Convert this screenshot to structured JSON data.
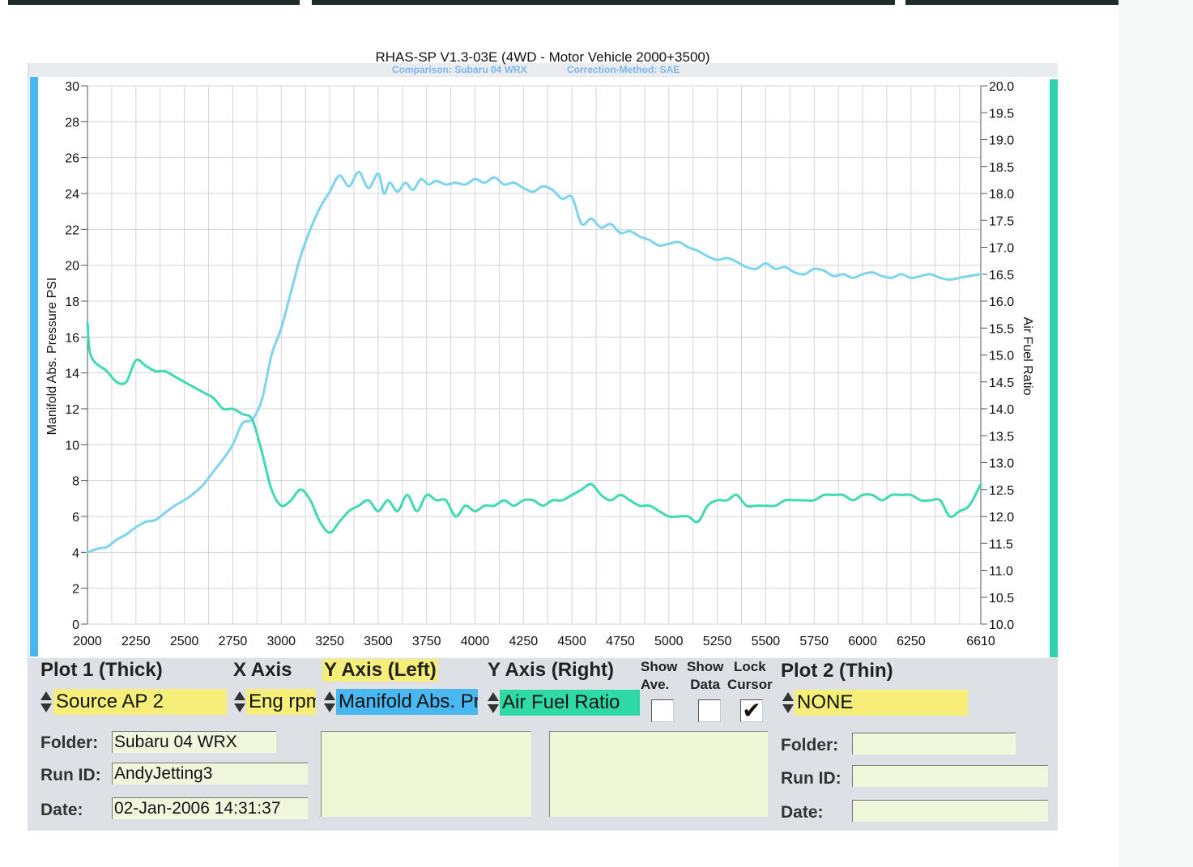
{
  "header": {
    "title": "RHAS-SP V1.3-03E  (4WD - Motor Vehicle 2000+3500)",
    "comparison": "Comparison: Subaru 04 WRX",
    "correction": "Correction-Method: SAE"
  },
  "colors": {
    "left_series": "#7cd4ee",
    "right_series": "#3fd9b3",
    "left_accent": "#45b7ee",
    "right_accent": "#2fd3a9",
    "plot1_highlight": "#f5ef7a",
    "y_left_highlight": "#49b8f0",
    "y_right_highlight": "#2fd9a6"
  },
  "chart_data": {
    "type": "line",
    "title": "RHAS-SP V1.3-03E  (4WD - Motor Vehicle 2000+3500)",
    "xlabel": "",
    "ylabel": "Manifold Abs. Pressure PSI",
    "y2label": "Air Fuel Ratio",
    "xlim": [
      2000,
      6610
    ],
    "ylim": [
      0,
      30
    ],
    "y2lim": [
      10.0,
      20.0
    ],
    "x_ticks": [
      "2000",
      "2250",
      "2500",
      "2750",
      "3000",
      "3250",
      "3500",
      "3750",
      "4000",
      "4250",
      "4500",
      "4750",
      "5000",
      "5250",
      "5500",
      "5750",
      "6000",
      "6250",
      "6610"
    ],
    "y_ticks": [
      "0",
      "2",
      "4",
      "6",
      "8",
      "10",
      "12",
      "14",
      "16",
      "18",
      "20",
      "22",
      "24",
      "26",
      "28",
      "30"
    ],
    "y2_ticks": [
      "10.0",
      "10.5",
      "11.0",
      "11.5",
      "12.0",
      "12.5",
      "13.0",
      "13.5",
      "14.0",
      "14.5",
      "15.0",
      "15.5",
      "16.0",
      "16.5",
      "17.0",
      "17.5",
      "18.0",
      "18.5",
      "19.0",
      "19.5",
      "20.0"
    ],
    "grid": true,
    "series": [
      {
        "name": "Manifold Abs. Pressure PSI",
        "axis": "left",
        "x": [
          2000,
          2050,
          2100,
          2150,
          2200,
          2250,
          2300,
          2350,
          2400,
          2450,
          2500,
          2550,
          2600,
          2650,
          2700,
          2750,
          2800,
          2850,
          2900,
          2950,
          3000,
          3050,
          3100,
          3150,
          3200,
          3250,
          3300,
          3350,
          3400,
          3450,
          3500,
          3530,
          3560,
          3600,
          3640,
          3680,
          3720,
          3760,
          3800,
          3850,
          3900,
          3950,
          4000,
          4050,
          4100,
          4150,
          4200,
          4250,
          4300,
          4350,
          4400,
          4450,
          4500,
          4550,
          4600,
          4650,
          4700,
          4750,
          4800,
          4850,
          4900,
          4950,
          5000,
          5050,
          5100,
          5150,
          5200,
          5250,
          5300,
          5350,
          5400,
          5450,
          5500,
          5550,
          5600,
          5650,
          5700,
          5750,
          5800,
          5850,
          5900,
          5950,
          6000,
          6050,
          6100,
          6150,
          6200,
          6250,
          6300,
          6350,
          6400,
          6450,
          6500,
          6550,
          6610
        ],
        "values": [
          4.0,
          4.2,
          4.3,
          4.7,
          5.0,
          5.4,
          5.7,
          5.8,
          6.2,
          6.6,
          6.9,
          7.3,
          7.8,
          8.5,
          9.2,
          10.0,
          11.2,
          11.4,
          12.5,
          15.0,
          16.5,
          18.5,
          20.5,
          22.0,
          23.2,
          24.1,
          25.0,
          24.4,
          25.2,
          24.3,
          25.1,
          24.0,
          24.6,
          24.1,
          24.6,
          24.2,
          24.8,
          24.5,
          24.7,
          24.5,
          24.6,
          24.5,
          24.8,
          24.6,
          24.9,
          24.5,
          24.6,
          24.3,
          24.1,
          24.4,
          24.2,
          23.7,
          23.8,
          22.3,
          22.6,
          22.1,
          22.3,
          21.8,
          21.9,
          21.6,
          21.4,
          21.1,
          21.2,
          21.3,
          21.0,
          20.8,
          20.5,
          20.3,
          20.4,
          20.2,
          19.9,
          19.8,
          20.1,
          19.8,
          19.9,
          19.6,
          19.5,
          19.8,
          19.7,
          19.4,
          19.5,
          19.3,
          19.5,
          19.6,
          19.4,
          19.3,
          19.5,
          19.3,
          19.4,
          19.5,
          19.3,
          19.2,
          19.3,
          19.4,
          19.5
        ]
      },
      {
        "name": "Air Fuel Ratio",
        "axis": "right",
        "x": [
          2000,
          2010,
          2030,
          2060,
          2100,
          2150,
          2200,
          2250,
          2300,
          2350,
          2400,
          2450,
          2500,
          2550,
          2600,
          2650,
          2700,
          2750,
          2800,
          2850,
          2900,
          2950,
          3000,
          3050,
          3100,
          3150,
          3200,
          3250,
          3300,
          3350,
          3400,
          3450,
          3500,
          3550,
          3600,
          3650,
          3700,
          3750,
          3800,
          3850,
          3900,
          3950,
          4000,
          4050,
          4100,
          4150,
          4200,
          4250,
          4300,
          4350,
          4400,
          4450,
          4500,
          4550,
          4600,
          4650,
          4700,
          4750,
          4800,
          4850,
          4900,
          4950,
          5000,
          5050,
          5100,
          5150,
          5200,
          5250,
          5300,
          5350,
          5400,
          5450,
          5500,
          5550,
          5600,
          5650,
          5700,
          5750,
          5800,
          5850,
          5900,
          5950,
          6000,
          6050,
          6100,
          6150,
          6200,
          6250,
          6300,
          6350,
          6400,
          6450,
          6500,
          6550,
          6610
        ],
        "values": [
          15.6,
          15.1,
          14.9,
          14.8,
          14.7,
          14.5,
          14.5,
          14.9,
          14.8,
          14.7,
          14.7,
          14.6,
          14.5,
          14.4,
          14.3,
          14.2,
          14.0,
          14.0,
          13.9,
          13.8,
          13.2,
          12.5,
          12.2,
          12.3,
          12.5,
          12.3,
          11.9,
          11.7,
          11.9,
          12.1,
          12.2,
          12.3,
          12.1,
          12.3,
          12.1,
          12.4,
          12.1,
          12.4,
          12.3,
          12.3,
          12.0,
          12.2,
          12.1,
          12.2,
          12.2,
          12.3,
          12.2,
          12.3,
          12.3,
          12.2,
          12.3,
          12.3,
          12.4,
          12.5,
          12.6,
          12.4,
          12.3,
          12.4,
          12.3,
          12.2,
          12.2,
          12.1,
          12.0,
          12.0,
          12.0,
          11.9,
          12.2,
          12.3,
          12.3,
          12.4,
          12.2,
          12.2,
          12.2,
          12.2,
          12.3,
          12.3,
          12.3,
          12.3,
          12.4,
          12.4,
          12.4,
          12.3,
          12.4,
          12.4,
          12.3,
          12.4,
          12.4,
          12.4,
          12.3,
          12.3,
          12.3,
          12.0,
          12.1,
          12.2,
          12.6
        ]
      }
    ]
  },
  "panel": {
    "plot1_heading": "Plot 1 (Thick)",
    "x_axis_heading": "X Axis",
    "y_left_heading": "Y Axis (Left)",
    "y_right_heading": "Y Axis (Right)",
    "show_ave_line1": "Show",
    "show_ave_line2": "Ave.",
    "show_data_line1": "Show",
    "show_data_line2": "Data",
    "lock_cursor_line1": "Lock",
    "lock_cursor_line2": "Cursor",
    "plot2_heading": "Plot 2 (Thin)",
    "plot1_source": "Source AP 2",
    "x_axis_value": "Eng rpm",
    "y_left_value": "Manifold Abs. Pressure PSI",
    "y_right_value": "Air Fuel Ratio",
    "plot2_source": "NONE",
    "show_ave_checked": false,
    "show_data_checked": false,
    "lock_cursor_checked": true,
    "check_mark": "✔",
    "folder_label": "Folder:",
    "run_id_label": "Run ID:",
    "date_label": "Date:",
    "plot1_folder": "Subaru 04 WRX",
    "plot1_run_id": "AndyJetting3",
    "plot1_date": "02-Jan-2006  14:31:37",
    "plot2_folder": "",
    "plot2_run_id": "",
    "plot2_date": ""
  }
}
